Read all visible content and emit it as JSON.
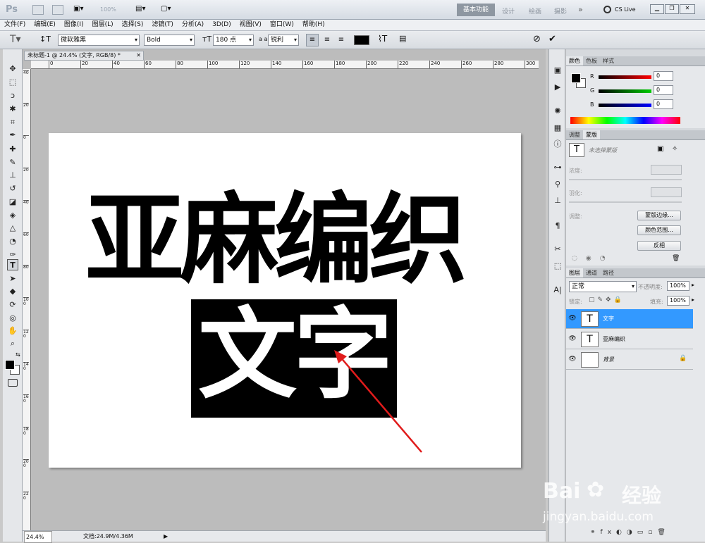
{
  "app": {
    "logo": "Ps",
    "zoom": "100%",
    "workspaces": [
      "基本功能",
      "设计",
      "绘画",
      "摄影"
    ],
    "cslive": "CS Live"
  },
  "menu": [
    "文件(F)",
    "编辑(E)",
    "图像(I)",
    "图层(L)",
    "选择(S)",
    "滤镜(T)",
    "分析(A)",
    "3D(D)",
    "视图(V)",
    "窗口(W)",
    "帮助(H)"
  ],
  "options": {
    "font_family": "微软雅黑",
    "font_style": "Bold",
    "font_size": "180 点",
    "aa_label": "a a",
    "antialias": "锐利"
  },
  "document": {
    "tab": "未标题-1 @ 24.4% (文字, RGB/8) *",
    "ruler_ticks": [
      "0",
      "20",
      "40",
      "60",
      "80",
      "100",
      "120",
      "140",
      "160",
      "180",
      "200",
      "220",
      "240",
      "260",
      "280",
      "300"
    ],
    "vruler_ticks": [
      "40",
      "20",
      "0",
      "20",
      "40",
      "60",
      "80",
      "100",
      "120",
      "140",
      "160",
      "180",
      "200",
      "220"
    ],
    "text_line1": "亚麻编织",
    "text_line2": "文字"
  },
  "status": {
    "zoom": "24.4%",
    "doc": "文档:24.9M/4.36M"
  },
  "color_panel": {
    "tabs": [
      "颜色",
      "色板",
      "样式"
    ],
    "r_label": "R",
    "g_label": "G",
    "b_label": "B",
    "r": "0",
    "g": "0",
    "b": "0"
  },
  "mask_panel": {
    "tabs": [
      "调整",
      "蒙版"
    ],
    "status": "未选择蒙版",
    "density": "浓度:",
    "feather": "羽化:",
    "adjust": "调整:",
    "btn_edge": "蒙版边缘...",
    "btn_range": "颜色范围...",
    "btn_invert": "反相"
  },
  "layers_panel": {
    "tabs": [
      "图层",
      "通道",
      "路径"
    ],
    "blend": "正常",
    "opacity_label": "不透明度:",
    "opacity": "100%",
    "lock_label": "锁定:",
    "fill_label": "填充:",
    "fill": "100%",
    "layers": [
      {
        "name": "文字",
        "thumb": "T"
      },
      {
        "name": "亚麻编织",
        "thumb": "T"
      },
      {
        "name": "背景",
        "thumb": ""
      }
    ]
  },
  "watermark": {
    "brand": "Bai",
    "brand2": "经验",
    "url": "jingyan.baidu.com"
  },
  "colors": {
    "accent": "#3ba0f2",
    "arrow": "#e01b1b",
    "selected_layer": "#3399ff"
  }
}
